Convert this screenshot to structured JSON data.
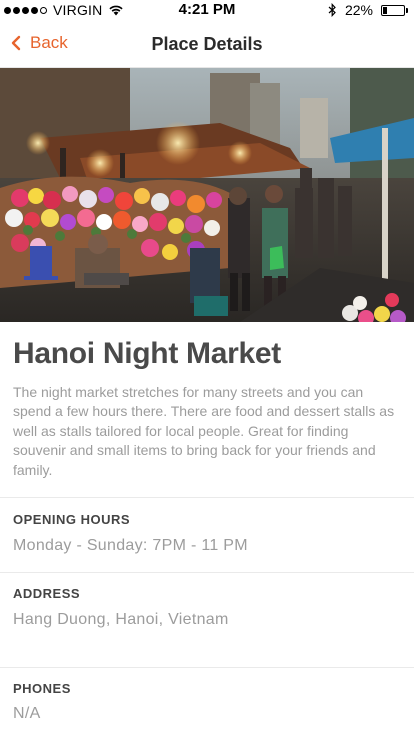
{
  "status_bar": {
    "carrier": "VIRGIN",
    "time": "4:21 PM",
    "battery": "22%",
    "battery_level": 0.22
  },
  "nav": {
    "back_label": "Back",
    "title": "Place Details"
  },
  "place": {
    "name": "Hanoi Night Market",
    "description": "The night market stretches for many streets and you can spend a few hours there. There are food and dessert stalls as well as stalls tailored for local people. Great for finding souvenir and small items to bring back for your friends and family."
  },
  "sections": {
    "opening_hours": {
      "label": "OPENING HOURS",
      "value": "Monday - Sunday: 7PM - 11 PM"
    },
    "address": {
      "label": "ADDRESS",
      "value": "Hang Duong, Hanoi, Vietnam"
    },
    "phones": {
      "label": "PHONES",
      "value": "N/A"
    }
  },
  "colors": {
    "accent": "#e7642d",
    "title": "#4a4a4a",
    "muted": "#9c9c9c"
  },
  "icons": {
    "back": "chevron-left-icon",
    "wifi": "wifi-icon",
    "bluetooth": "bluetooth-icon",
    "battery": "battery-icon"
  }
}
